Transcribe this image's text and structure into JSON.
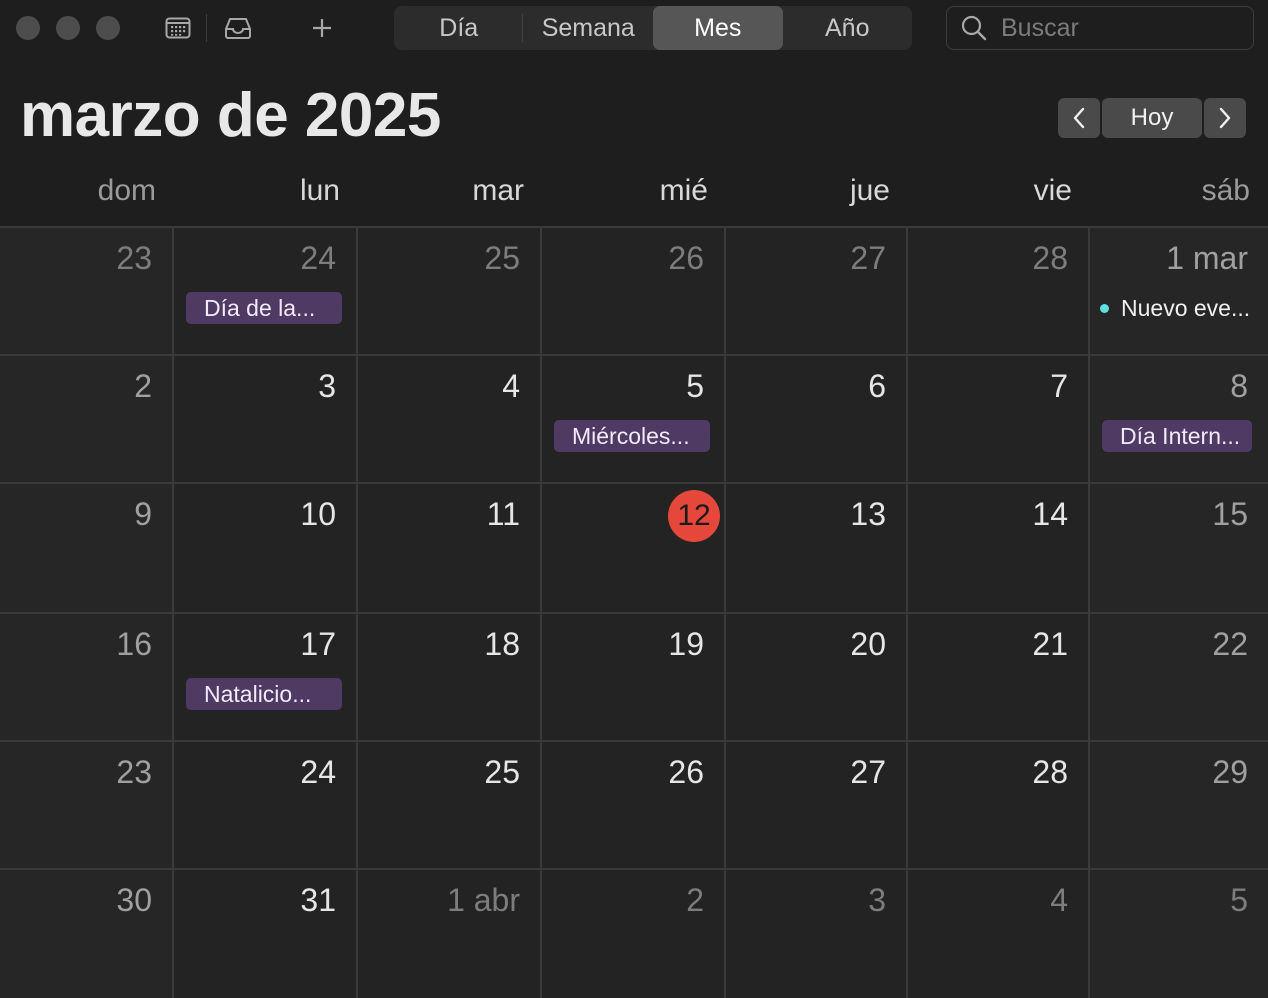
{
  "toolbar": {
    "view_tabs": [
      {
        "label": "Día",
        "selected": false
      },
      {
        "label": "Semana",
        "selected": false
      },
      {
        "label": "Mes",
        "selected": true
      },
      {
        "label": "Año",
        "selected": false
      }
    ],
    "search": {
      "placeholder": "Buscar",
      "value": ""
    },
    "icons": [
      "calendar-list-icon",
      "inbox-icon",
      "plus-icon",
      "search-icon"
    ]
  },
  "header": {
    "title": "marzo de 2025",
    "today_label": "Hoy"
  },
  "weekdays": [
    "dom",
    "lun",
    "mar",
    "mié",
    "jue",
    "vie",
    "sáb"
  ],
  "weeks": [
    [
      {
        "label": "23",
        "muted": true
      },
      {
        "label": "24",
        "muted": true,
        "event": {
          "title": "Día de la...",
          "style": "bar"
        }
      },
      {
        "label": "25",
        "muted": true
      },
      {
        "label": "26",
        "muted": true
      },
      {
        "label": "27",
        "muted": true
      },
      {
        "label": "28",
        "muted": true
      },
      {
        "label": "1 mar",
        "muted": false,
        "event": {
          "title": "Nuevo eve...",
          "style": "dot"
        }
      }
    ],
    [
      {
        "label": "2"
      },
      {
        "label": "3"
      },
      {
        "label": "4"
      },
      {
        "label": "5",
        "event": {
          "title": "Miércoles...",
          "style": "bar"
        }
      },
      {
        "label": "6"
      },
      {
        "label": "7"
      },
      {
        "label": "8",
        "event": {
          "title": "Día Intern...",
          "style": "bar"
        }
      }
    ],
    [
      {
        "label": "9"
      },
      {
        "label": "10"
      },
      {
        "label": "11"
      },
      {
        "label": "12",
        "today": true
      },
      {
        "label": "13"
      },
      {
        "label": "14"
      },
      {
        "label": "15"
      }
    ],
    [
      {
        "label": "16"
      },
      {
        "label": "17",
        "event": {
          "title": "Natalicio...",
          "style": "bar"
        }
      },
      {
        "label": "18"
      },
      {
        "label": "19"
      },
      {
        "label": "20"
      },
      {
        "label": "21"
      },
      {
        "label": "22"
      }
    ],
    [
      {
        "label": "23"
      },
      {
        "label": "24"
      },
      {
        "label": "25"
      },
      {
        "label": "26"
      },
      {
        "label": "27"
      },
      {
        "label": "28"
      },
      {
        "label": "29"
      }
    ],
    [
      {
        "label": "30"
      },
      {
        "label": "31"
      },
      {
        "label": "1 abr",
        "muted": true
      },
      {
        "label": "2",
        "muted": true
      },
      {
        "label": "3",
        "muted": true
      },
      {
        "label": "4",
        "muted": true
      },
      {
        "label": "5",
        "muted": true
      }
    ]
  ],
  "colors": {
    "today": "#e5483a",
    "holiday_event": "#4f3a64",
    "calendar_dot": "#5de0e0",
    "selected_tab": "#565656"
  }
}
